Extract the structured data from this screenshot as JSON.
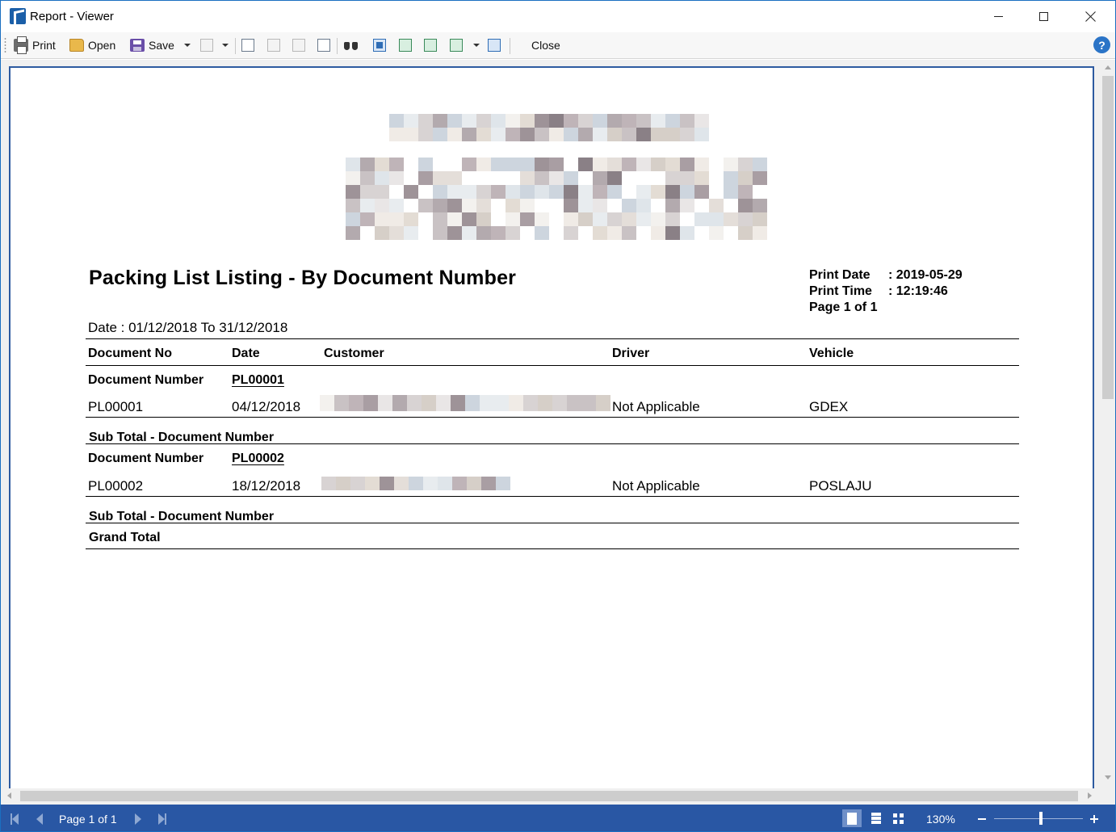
{
  "window": {
    "title": "Report - Viewer"
  },
  "toolbar": {
    "print_label": "Print",
    "open_label": "Open",
    "save_label": "Save",
    "close_label": "Close",
    "help_glyph": "?"
  },
  "report": {
    "title": "Packing List Listing - By Document Number",
    "print_date_label": "Print Date",
    "print_date_value": ": 2019-05-29",
    "print_time_label": "Print Time",
    "print_time_value": ": 12:19:46",
    "page_info": "Page 1 of 1",
    "date_range": "Date : 01/12/2018 To 31/12/2018",
    "columns": [
      "Document No",
      "Date",
      "Customer",
      "Driver",
      "Vehicle"
    ],
    "groups": [
      {
        "group_label": "Document Number",
        "group_value": "PL00001",
        "row": {
          "doc_no": "PL00001",
          "date": "04/12/2018",
          "driver": "Not Applicable",
          "vehicle": "GDEX"
        },
        "subtotal_label": "Sub Total - Document Number"
      },
      {
        "group_label": "Document Number",
        "group_value": "PL00002",
        "row": {
          "doc_no": "PL00002",
          "date": "18/12/2018",
          "driver": "Not Applicable",
          "vehicle": "POSLAJU"
        },
        "subtotal_label": "Sub Total - Document Number"
      }
    ],
    "grand_total_label": "Grand Total"
  },
  "statusbar": {
    "page_label": "Page 1 of 1",
    "zoom": "130%",
    "zoom_level": 0.53
  },
  "icons": {
    "app": "report-app-icon",
    "print": "printer-icon",
    "open": "folder-open-icon",
    "save": "floppy-disk-icon",
    "find": "binoculars-icon",
    "help": "help-icon"
  },
  "colors": {
    "statusbar_bg": "#2957a4",
    "page_border": "#2d5aa0",
    "help_blue": "#2b74c7"
  }
}
